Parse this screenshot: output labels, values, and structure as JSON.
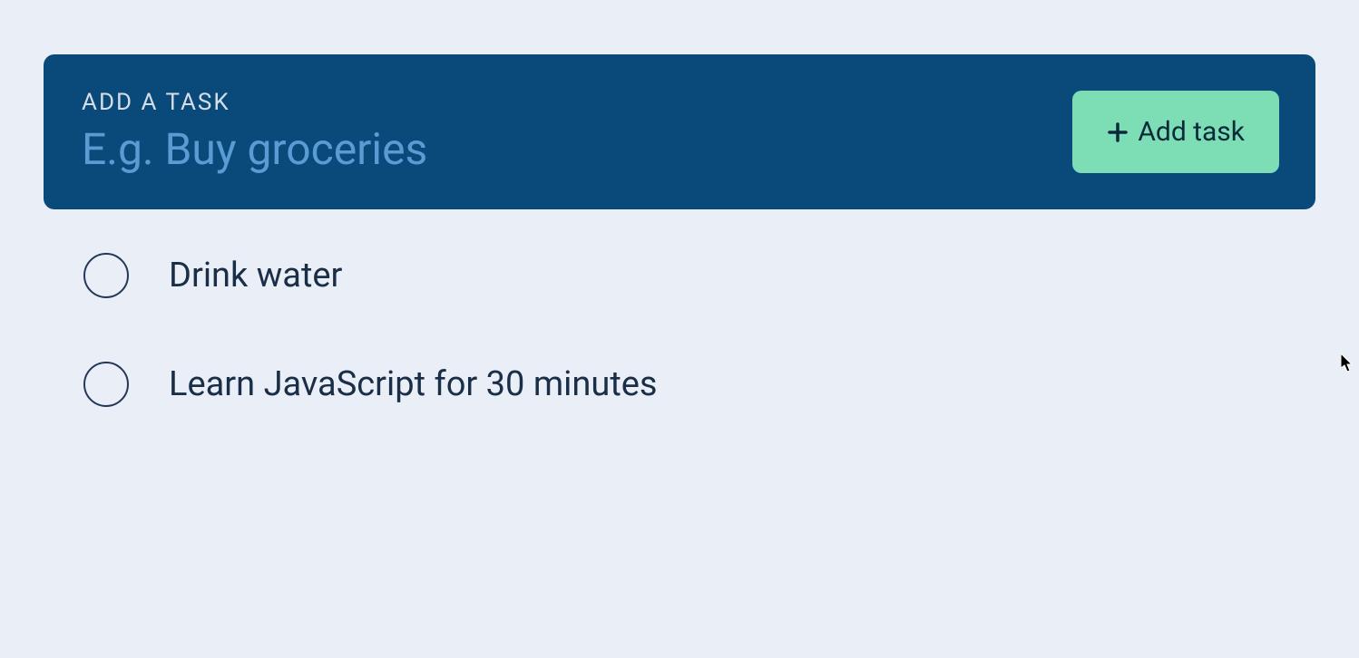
{
  "addTask": {
    "label": "Add a task",
    "placeholder": "E.g. Buy groceries",
    "buttonLabel": "Add task"
  },
  "tasks": [
    {
      "text": "Drink water"
    },
    {
      "text": "Learn JavaScript for 30 minutes"
    }
  ]
}
